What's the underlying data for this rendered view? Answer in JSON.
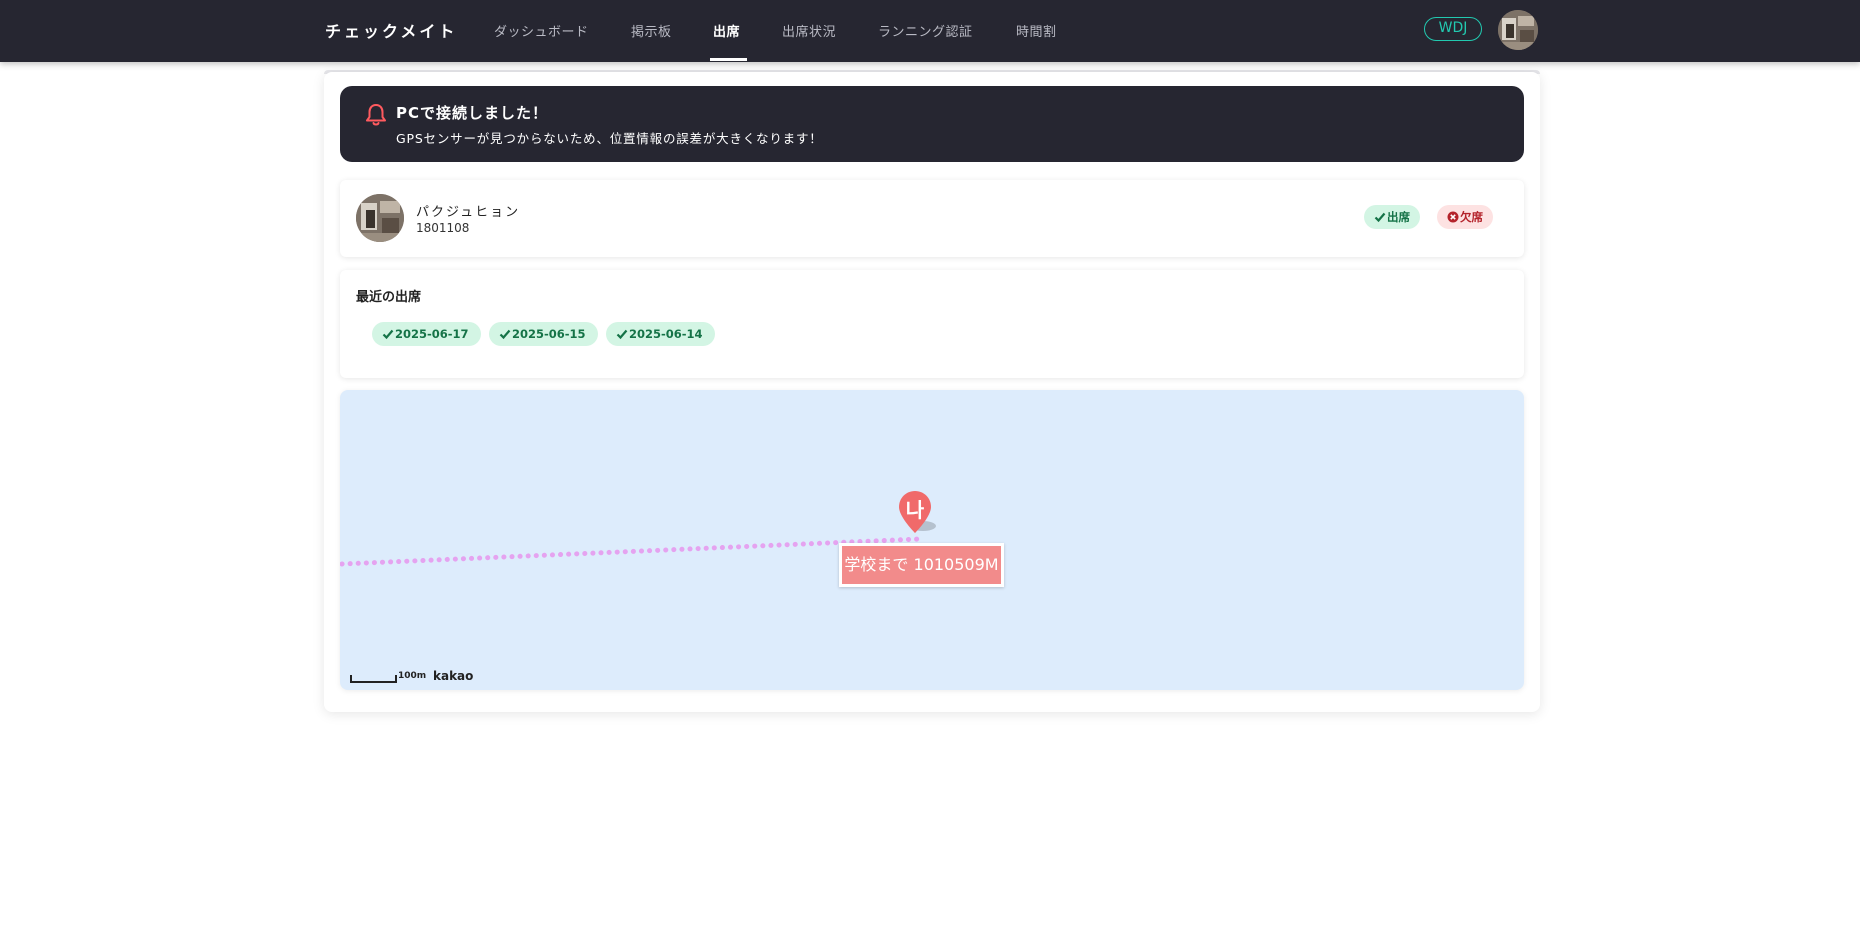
{
  "nav": {
    "brand": "チェックメイト",
    "items": [
      {
        "label": "ダッシュボード",
        "active": false
      },
      {
        "label": "掲示板",
        "active": false
      },
      {
        "label": "出席",
        "active": true
      },
      {
        "label": "出席状況",
        "active": false
      },
      {
        "label": "ランニング認証",
        "active": false
      },
      {
        "label": "時間割",
        "active": false
      }
    ],
    "user_badge": "WDJ",
    "avatar_icon": "user-avatar-icon"
  },
  "alert": {
    "icon": "bell-icon",
    "title": "PCで接続しました！",
    "message": "GPSセンサーが見つからないため、位置情報の誤差が大きくなります！",
    "icon_color": "#ff5a5f"
  },
  "profile": {
    "name": "パクジュヒョン",
    "student_id": "1801108",
    "status_present": "出席",
    "status_absent": "欠席"
  },
  "recent": {
    "title": "最近の出席",
    "dates": [
      "2025-06-17",
      "2025-06-15",
      "2025-06-14"
    ]
  },
  "map": {
    "marker_label": "나",
    "distance_text": "学校まで 1010509M",
    "scale_label": "100m",
    "provider": "kakao",
    "route_color": "#e5a3f0",
    "marker_color": "#f06a6a"
  },
  "colors": {
    "navbar": "#262631",
    "accent": "#22c9b0",
    "present_bg": "#d3f5e4",
    "absent_bg": "#fde2e2"
  }
}
